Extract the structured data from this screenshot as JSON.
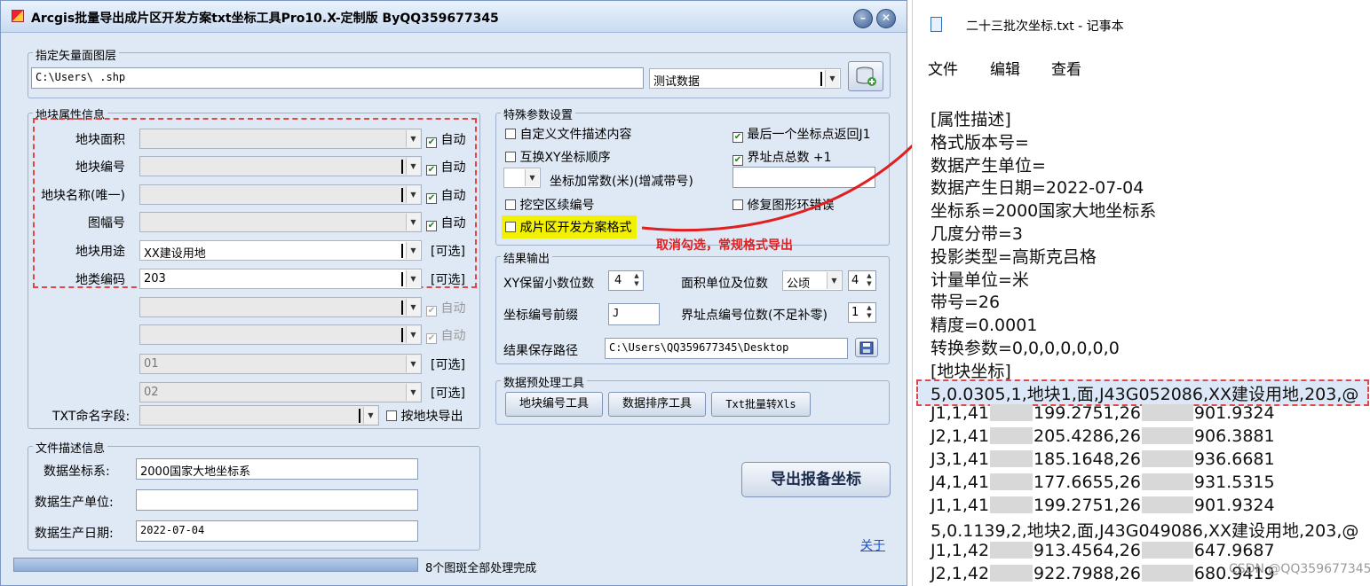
{
  "app": {
    "title": "Arcgis批量导出成片区开发方案txt坐标工具Pro10.X-定制版 ByQQ359677345"
  },
  "layer": {
    "group_title": "指定矢量面图层",
    "path": "C:\\Users\\          .shp",
    "layer_combo": "测试数据"
  },
  "attr": {
    "group_title": "地块属性信息",
    "rows": [
      {
        "label": "地块面积",
        "value": "",
        "check": "自动",
        "checked": "✔"
      },
      {
        "label": "地块编号",
        "value": "",
        "check": "自动",
        "checked": "✔"
      },
      {
        "label": "地块名称(唯一)",
        "value": "",
        "check": "自动",
        "checked": "✔"
      },
      {
        "label": "图幅号",
        "value": "",
        "check": "自动",
        "checked": "✔"
      },
      {
        "label": "地块用途",
        "value": "XX建设用地",
        "check": "[可选]"
      },
      {
        "label": "地类编码",
        "value": "203",
        "check": "[可选]"
      },
      {
        "label": "",
        "value": "",
        "check": "自动",
        "checked": "✔"
      },
      {
        "label": "",
        "value": "",
        "check": "自动",
        "checked": "✔"
      },
      {
        "label": "",
        "value": "01",
        "check": "[可选]"
      },
      {
        "label": "",
        "value": "02",
        "check": "[可选]"
      }
    ],
    "txt_label": "TXT命名字段:",
    "by_block": "按地块导出"
  },
  "special": {
    "group_title": "特殊参数设置",
    "custom_desc": "自定义文件描述内容",
    "swap_xy": "互换XY坐标顺序",
    "add_const": "坐标加常数(米)(增减带号)",
    "hollow": "挖空区续编号",
    "format": "成片区开发方案格式",
    "last_return": "最后一个坐标点返回J1",
    "total_pts": "界址点总数 +1",
    "fix_ring": "修复图形环错误",
    "check_mark": "✔"
  },
  "annotation": "取消勾选，常规格式导出",
  "output": {
    "group_title": "结果输出",
    "decimals_label": "XY保留小数位数",
    "decimals": "4",
    "area_unit_label": "面积单位及位数",
    "area_unit": "公顷",
    "area_digits": "4",
    "prefix_label": "坐标编号前缀",
    "prefix": "J",
    "pt_digits_label": "界址点编号位数(不足补零)",
    "pt_digits": "1",
    "save_label": "结果保存路径",
    "save_path": "C:\\Users\\QQ359677345\\Desktop"
  },
  "preproc": {
    "group_title": "数据预处理工具",
    "btn1": "地块编号工具",
    "btn2": "数据排序工具",
    "btn3": "Txt批量转Xls"
  },
  "filedesc": {
    "group_title": "文件描述信息",
    "crs_label": "数据坐标系:",
    "crs": "2000国家大地坐标系",
    "unit_label": "数据生产单位:",
    "unit": "",
    "date_label": "数据生产日期:",
    "date": "2022-07-04"
  },
  "export_btn": "导出报备坐标",
  "about": "关于",
  "status": "8个图斑全部处理完成",
  "notepad": {
    "title": "二十三批次坐标.txt - 记事本",
    "menu": [
      "文件",
      "编辑",
      "查看"
    ],
    "lines": [
      "[属性描述]",
      "格式版本号=",
      "数据产生单位=",
      "数据产生日期=2022-07-04",
      "坐标系=2000国家大地坐标系",
      "几度分带=3",
      "投影类型=高斯克吕格",
      "计量单位=米",
      "带号=26",
      "精度=0.0001",
      "转换参数=0,0,0,0,0,0,0",
      "[地块坐标]",
      "5,0.0305,1,地块1,面,J43G052086,XX建设用地,203,@"
    ],
    "coords": [
      [
        "J1,1,41",
        "199.2751,26",
        "901.9324"
      ],
      [
        "J2,1,41",
        "205.4286,26",
        "906.3881"
      ],
      [
        "J3,1,41",
        "185.1648,26",
        "936.6681"
      ],
      [
        "J4,1,41",
        "177.6655,26",
        "931.5315"
      ],
      [
        "J1,1,41",
        "199.2751,26",
        "901.9324"
      ]
    ],
    "line2": "5,0.1139,2,地块2,面,J43G049086,XX建设用地,203,@",
    "coords2": [
      [
        "J1,1,42",
        "913.4564,26",
        "647.9687"
      ],
      [
        "J2,1,42",
        "922.7988,26",
        "680.9419"
      ]
    ],
    "watermark": "CSDN @QQ359677345"
  }
}
